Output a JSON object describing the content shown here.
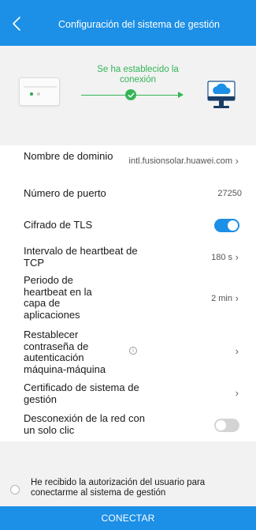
{
  "header": {
    "title": "Configuración del sistema de gestión"
  },
  "status": {
    "connection_text": "Se ha establecido la conexión"
  },
  "settings": {
    "domain": {
      "label": "Nombre de dominio",
      "value": "intl.fusionsolar.huawei.com"
    },
    "port": {
      "label": "Número de puerto",
      "value": "27250"
    },
    "tls": {
      "label": "Cifrado de TLS",
      "enabled": true
    },
    "heartbeat_tcp": {
      "label": "Intervalo de heartbeat de TCP",
      "value": "180 s"
    },
    "heartbeat_app": {
      "label": "Periodo de heartbeat en la capa de aplicaciones",
      "value": "2 min"
    },
    "reset_password": {
      "label": "Restablecer contraseña de autenticación máquina-máquina"
    },
    "certificate": {
      "label": "Certificado de sistema de gestión"
    },
    "one_click_disconnect": {
      "label": "Desconexión de la red con un solo clic",
      "enabled": false
    }
  },
  "authorization": {
    "text": "He recibido la autorización del usuario para conectarme al sistema de gestión",
    "checked": false
  },
  "actions": {
    "connect_label": "CONECTAR"
  },
  "icons": {
    "back": "chevron-left-icon",
    "chevron": "chevron-right-icon",
    "info": "info-icon",
    "check": "check-icon",
    "cloud_monitor": "cloud-monitor-icon",
    "device": "inverter-device-icon"
  },
  "colors": {
    "primary": "#1c8fe6",
    "success": "#35b558",
    "toggle_off": "#d4d4d4"
  }
}
